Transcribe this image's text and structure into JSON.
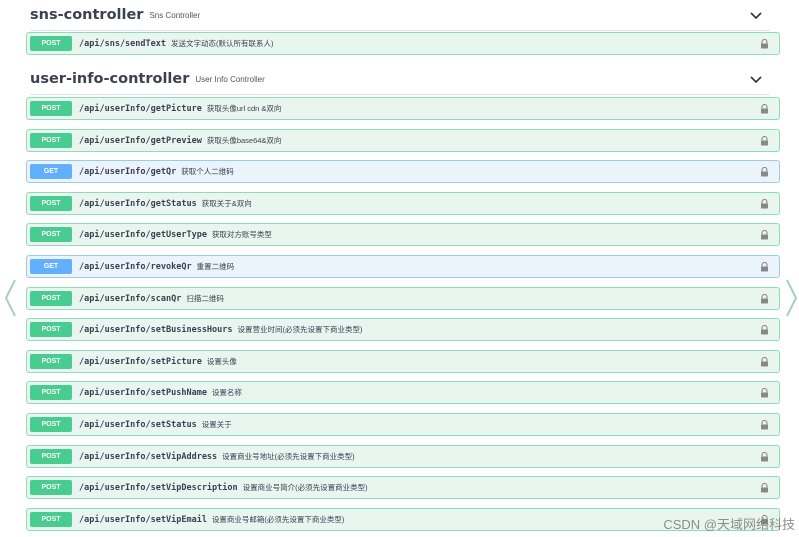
{
  "sns": {
    "title": "sns-controller",
    "subtitle": "Sns Controller",
    "ops": [
      {
        "method": "POST",
        "path": "/api/sns/sendText",
        "desc": "发送文字动态(默认所有联系人)"
      }
    ]
  },
  "userinfo": {
    "title": "user-info-controller",
    "subtitle": "User Info Controller",
    "ops": [
      {
        "method": "POST",
        "path": "/api/userInfo/getPicture",
        "desc": "获取头像url cdn &双向"
      },
      {
        "method": "POST",
        "path": "/api/userInfo/getPreview",
        "desc": "获取头像base64&双向"
      },
      {
        "method": "GET",
        "path": "/api/userInfo/getQr",
        "desc": "获取个人二维码"
      },
      {
        "method": "POST",
        "path": "/api/userInfo/getStatus",
        "desc": "获取关于&双向"
      },
      {
        "method": "POST",
        "path": "/api/userInfo/getUserType",
        "desc": "获取对方账号类型"
      },
      {
        "method": "GET",
        "path": "/api/userInfo/revokeQr",
        "desc": "重置二维码"
      },
      {
        "method": "POST",
        "path": "/api/userInfo/scanQr",
        "desc": "扫描二维码"
      },
      {
        "method": "POST",
        "path": "/api/userInfo/setBusinessHours",
        "desc": "设置营业时间(必须先设置下商业类型)"
      },
      {
        "method": "POST",
        "path": "/api/userInfo/setPicture",
        "desc": "设置头像"
      },
      {
        "method": "POST",
        "path": "/api/userInfo/setPushName",
        "desc": "设置名称"
      },
      {
        "method": "POST",
        "path": "/api/userInfo/setStatus",
        "desc": "设置关于"
      },
      {
        "method": "POST",
        "path": "/api/userInfo/setVipAddress",
        "desc": "设置商业号地址(必须先设置下商业类型)"
      },
      {
        "method": "POST",
        "path": "/api/userInfo/setVipDescription",
        "desc": "设置商业号简介(必须先设置商业类型)"
      },
      {
        "method": "POST",
        "path": "/api/userInfo/setVipEmail",
        "desc": "设置商业号邮箱(必须先设置下商业类型)"
      }
    ]
  },
  "watermark": "CSDN @天域网络科技",
  "colors": {
    "post": "#49cc90",
    "get": "#61affe"
  }
}
